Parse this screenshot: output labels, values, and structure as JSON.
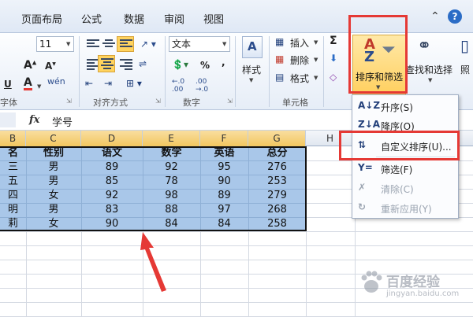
{
  "ribbon_tabs": [
    "页面布局",
    "公式",
    "数据",
    "审阅",
    "视图"
  ],
  "font": {
    "size": "11",
    "bold": "A",
    "underline": "U",
    "phonetic": "wén",
    "group_label": "字体"
  },
  "alignment": {
    "group_label": "对齐方式"
  },
  "number": {
    "format": "文本",
    "percent": "%",
    "comma": ",",
    "group_label": "数字"
  },
  "styles": {
    "label": "样式"
  },
  "cells": {
    "insert": "插入",
    "delete": "删除",
    "format": "格式",
    "group_label": "单元格"
  },
  "editing": {
    "sum": "Σ",
    "sort_filter": "排序和筛选",
    "find_select": "查找和选择",
    "share_partial": "照"
  },
  "formula_bar": {
    "fx": "fx",
    "value": "学号"
  },
  "columns": [
    "B",
    "C",
    "D",
    "E",
    "F",
    "G",
    "H"
  ],
  "table": {
    "headers": [
      "名",
      "性别",
      "语文",
      "数学",
      "英语",
      "总分"
    ],
    "rows": [
      [
        "三",
        "男",
        "89",
        "92",
        "95",
        "276"
      ],
      [
        "五",
        "男",
        "85",
        "78",
        "90",
        "253"
      ],
      [
        "四",
        "女",
        "92",
        "98",
        "89",
        "279"
      ],
      [
        "明",
        "男",
        "83",
        "88",
        "97",
        "268"
      ],
      [
        "莉",
        "女",
        "90",
        "84",
        "84",
        "258"
      ]
    ]
  },
  "menu": {
    "items": [
      {
        "icon": "A↓Z",
        "label": "升序(S)",
        "enabled": true
      },
      {
        "icon": "Z↓A",
        "label": "降序(O)",
        "enabled": true
      },
      {
        "icon": "⇅",
        "label": "自定义排序(U)...",
        "enabled": true
      },
      {
        "icon": "Y=",
        "label": "筛选(F)",
        "enabled": true
      },
      {
        "icon": "✗",
        "label": "清除(C)",
        "enabled": false
      },
      {
        "icon": "↻",
        "label": "重新应用(Y)",
        "enabled": false
      }
    ]
  },
  "colors": {
    "selection": "#a9c7e9",
    "highlight": "#e53935",
    "sort_button": "#ffcf5e"
  },
  "watermark": {
    "text": "百度经验",
    "url": "jingyan.baidu.com"
  }
}
